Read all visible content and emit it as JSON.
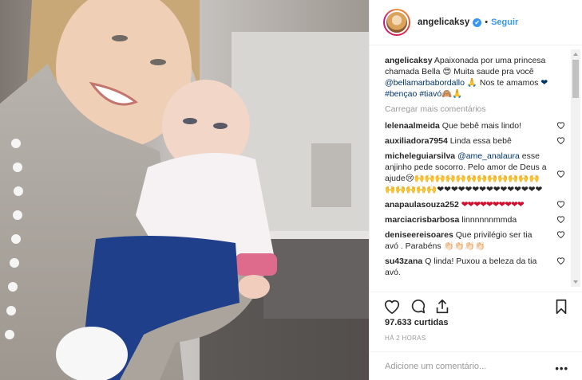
{
  "header": {
    "username": "angelicaksy",
    "verified_glyph": "✔",
    "separator": "•",
    "follow_label": "Seguir"
  },
  "caption": {
    "username": "angelicaksy",
    "text_1": "Apaixonada por uma princesa chamada Bella 😍 Muita saude pra você",
    "mention": "@bellamarbabordallo",
    "text_2": "🙏 Nos te amamos",
    "hashtags": "❤#bençao #tiavó🙈🙏"
  },
  "load_more": "Carregar mais comentários",
  "comments": [
    {
      "user": "lelenaalmeida",
      "text": "Que bebê mais lindo!"
    },
    {
      "user": "auxiliadora7954",
      "text": "Linda essa bebê"
    },
    {
      "user": "micheleguiarsilva",
      "mention": "@ame_analaura",
      "text": "esse anjinho pede socorro. Pelo amor de Deus a ajude😢🙌🙌🙌🙌🙌🙌🙌🙌🙌🙌🙌🙌🙌🙌🙌🙌🙌❤❤❤❤❤❤❤❤❤❤❤❤❤❤❤"
    },
    {
      "user": "anapaulasouza252",
      "text": "❤❤❤❤❤❤❤❤❤❤"
    },
    {
      "user": "marciacrisbarbosa",
      "text": "linnnnnnmmda"
    },
    {
      "user": "deniseereisoares",
      "text": "Que privilégio ser tia avó . Parabéns 👏🏻👏🏻👏🏻👏🏻"
    },
    {
      "user": "su43zana",
      "text": "Q linda! Puxou a beleza da tia avó."
    }
  ],
  "likes": "97.633 curtidas",
  "timestamp": "HÁ 2 HORAS",
  "add_comment_placeholder": "Adicione um comentário...",
  "more_options": "•••",
  "icons": {
    "like": "heart-icon",
    "comment": "comment-icon",
    "share": "share-icon",
    "save": "bookmark-icon"
  },
  "colors": {
    "link": "#3897f0",
    "text": "#262626",
    "muted": "#999999",
    "divider": "#efefef"
  }
}
